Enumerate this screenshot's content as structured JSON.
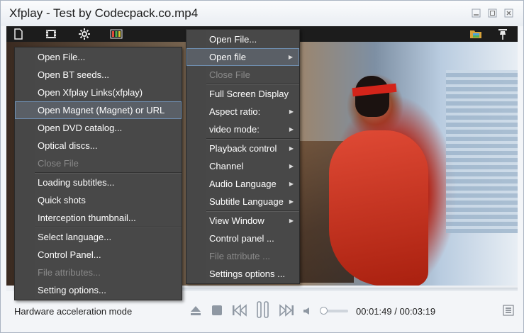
{
  "window": {
    "title": "Xfplay - Test by Codecpack.co.mp4",
    "controls": [
      "minimize-icon",
      "restore-icon",
      "close-icon"
    ]
  },
  "toolbar": {
    "left_icons": [
      "document-icon",
      "film-icon",
      "settings-icon",
      "color-bars-icon"
    ],
    "right_icons": [
      "folder-image-icon",
      "pin-icon"
    ]
  },
  "left_menu": {
    "items": [
      {
        "label": "Open File...",
        "disabled": false
      },
      {
        "label": "Open BT seeds...",
        "disabled": false
      },
      {
        "label": "Open Xfplay Links(xfplay)",
        "disabled": false
      },
      {
        "label": "Open Magnet (Magnet) or URL",
        "disabled": false,
        "highlighted": true
      },
      {
        "label": "Open DVD catalog...",
        "disabled": false
      },
      {
        "label": "Optical discs...",
        "disabled": false
      },
      {
        "label": "Close File",
        "disabled": true
      },
      {
        "label": "Loading subtitles...",
        "disabled": false
      },
      {
        "label": "Quick shots",
        "disabled": false
      },
      {
        "label": "Interception thumbnail...",
        "disabled": false
      },
      {
        "label": "Select language...",
        "disabled": false
      },
      {
        "label": "Control Panel...",
        "disabled": false
      },
      {
        "label": "File attributes...",
        "disabled": true
      },
      {
        "label": "Setting options...",
        "disabled": false
      }
    ]
  },
  "right_menu": {
    "items": [
      {
        "label": "Open File..."
      },
      {
        "label": "Open file",
        "submenu": true,
        "highlighted": true
      },
      {
        "label": "Close File",
        "disabled": true
      },
      {
        "label": "Full Screen Display"
      },
      {
        "label": "Aspect ratio:",
        "submenu": true
      },
      {
        "label": "video mode:",
        "submenu": true
      },
      {
        "label": "Playback control",
        "submenu": true
      },
      {
        "label": "Channel",
        "submenu": true
      },
      {
        "label": "Audio Language",
        "submenu": true
      },
      {
        "label": "Subtitle Language",
        "submenu": true
      },
      {
        "label": "View Window",
        "submenu": true
      },
      {
        "label": "Control panel ..."
      },
      {
        "label": "File attribute ...",
        "disabled": true
      },
      {
        "label": "Settings options ..."
      }
    ]
  },
  "status": {
    "mode": "Hardware acceleration mode",
    "elapsed": "00:01:49",
    "separator": "/",
    "duration": "00:03:19",
    "volume": 0
  },
  "colors": {
    "menu_bg": "#484848",
    "menu_highlight_border": "#6f8eb0",
    "toolbar_bg": "#1c1c1c",
    "control_icon": "#8f98a3"
  }
}
